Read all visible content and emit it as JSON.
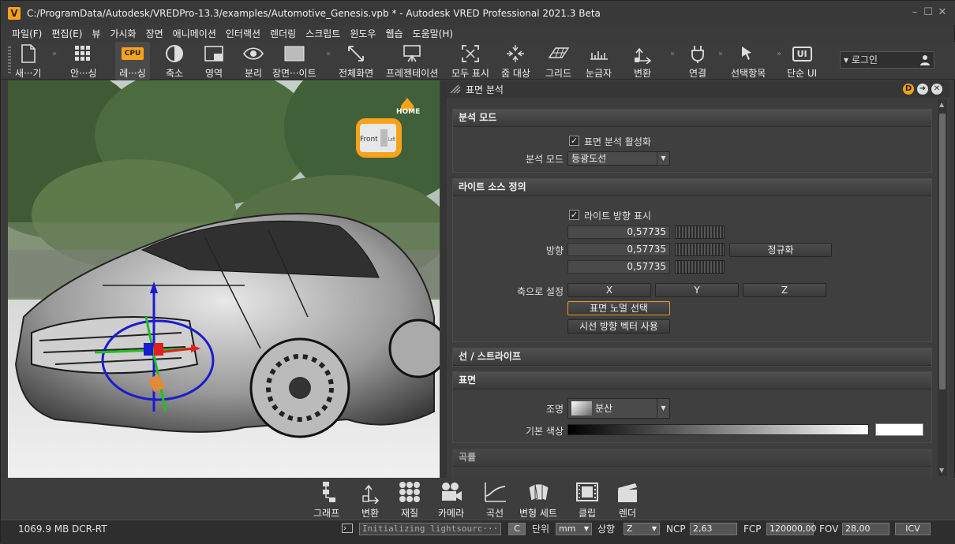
{
  "window": {
    "title": "C:/ProgramData/Autodesk/VREDPro-13.3/examples/Automotive_Genesis.vpb * - Autodesk VRED Professional 2021.3 Beta",
    "logo": "V",
    "min": "–",
    "max": "☐",
    "close": "✕"
  },
  "menu": [
    "파일(F)",
    "편집(E)",
    "뷰",
    "가시화",
    "장면",
    "애니메이션",
    "인터랙션",
    "렌더링",
    "스크립트",
    "윈도우",
    "웹습",
    "도움말(H)"
  ],
  "toolbar": {
    "new": "새···기",
    "quality": "안···싱",
    "render_mode": "레···싱",
    "cpu_badge": "CPU",
    "scale": "축소",
    "region": "영역",
    "split": "분리",
    "scene": "장면···이트",
    "fullscreen": "전체화면",
    "presentation": "프레젠테이션",
    "show_all": "모두 표시",
    "zoom_target": "줌 대상",
    "grid": "그리드",
    "ruler": "눈금자",
    "transform": "변환",
    "connect": "연결",
    "select_item": "선택항목",
    "simple_ui": "단순 UI",
    "simple_ui_badge": "UI",
    "sep": "»",
    "login": "▾ 로그인"
  },
  "viewport": {
    "home_label": "HOME",
    "cube_front": "Front",
    "cube_left": "Left"
  },
  "panel": {
    "title": "표면 분석",
    "head_icons": [
      "D",
      "➜",
      "✕"
    ],
    "sections": {
      "analysis_mode": {
        "header": "분석 모드",
        "enable_label": "표면 분석 활성화",
        "enable_checked": "✓",
        "mode_label": "분석 모드",
        "mode_value": "등광도선",
        "arrow": "▼"
      },
      "light_source": {
        "header": "라이트 소스 정의",
        "show_dir_label": "라이트 방향 표시",
        "show_dir_checked": "✓",
        "direction_label": "방향",
        "dir_x": "0,57735",
        "dir_y": "0,57735",
        "dir_z": "0,57735",
        "normalize": "정규화",
        "set_axis_label": "축으로 설정",
        "axis_x": "X",
        "axis_y": "Y",
        "axis_z": "Z",
        "pick_normal": "표면 노멀 선택",
        "use_view_dir": "시선 방향 벡터 사용"
      },
      "lines": {
        "header": "선 / 스트라이프"
      },
      "surface": {
        "header": "표면",
        "lighting_label": "조명",
        "lighting_value": "분산",
        "arrow": "▼",
        "base_color_label": "기본 색상"
      },
      "curvature": {
        "header": "곡률"
      }
    }
  },
  "bottom_toolbar": [
    "그래프",
    "변환",
    "재질",
    "카메라",
    "곡선",
    "변형 세트",
    "클립",
    "렌더"
  ],
  "status": {
    "memory": "1069.9 MB",
    "renderer": "DCR-RT",
    "console": "Initializing lightsourc···",
    "units_label": "단위",
    "units_value": "mm",
    "up_label": "상향",
    "up_value": "Z",
    "ncp_label": "NCP",
    "ncp_value": "2,63",
    "fcp_label": "FCP",
    "fcp_value": "120000,00",
    "fov_label": "FOV",
    "fov_value": "28,00",
    "icv": "ICV",
    "c_button": "C"
  },
  "colors": {
    "accent": "#f6a31b",
    "panel_bg": "#3d3d3d",
    "section_head": "#4a4a4a"
  }
}
